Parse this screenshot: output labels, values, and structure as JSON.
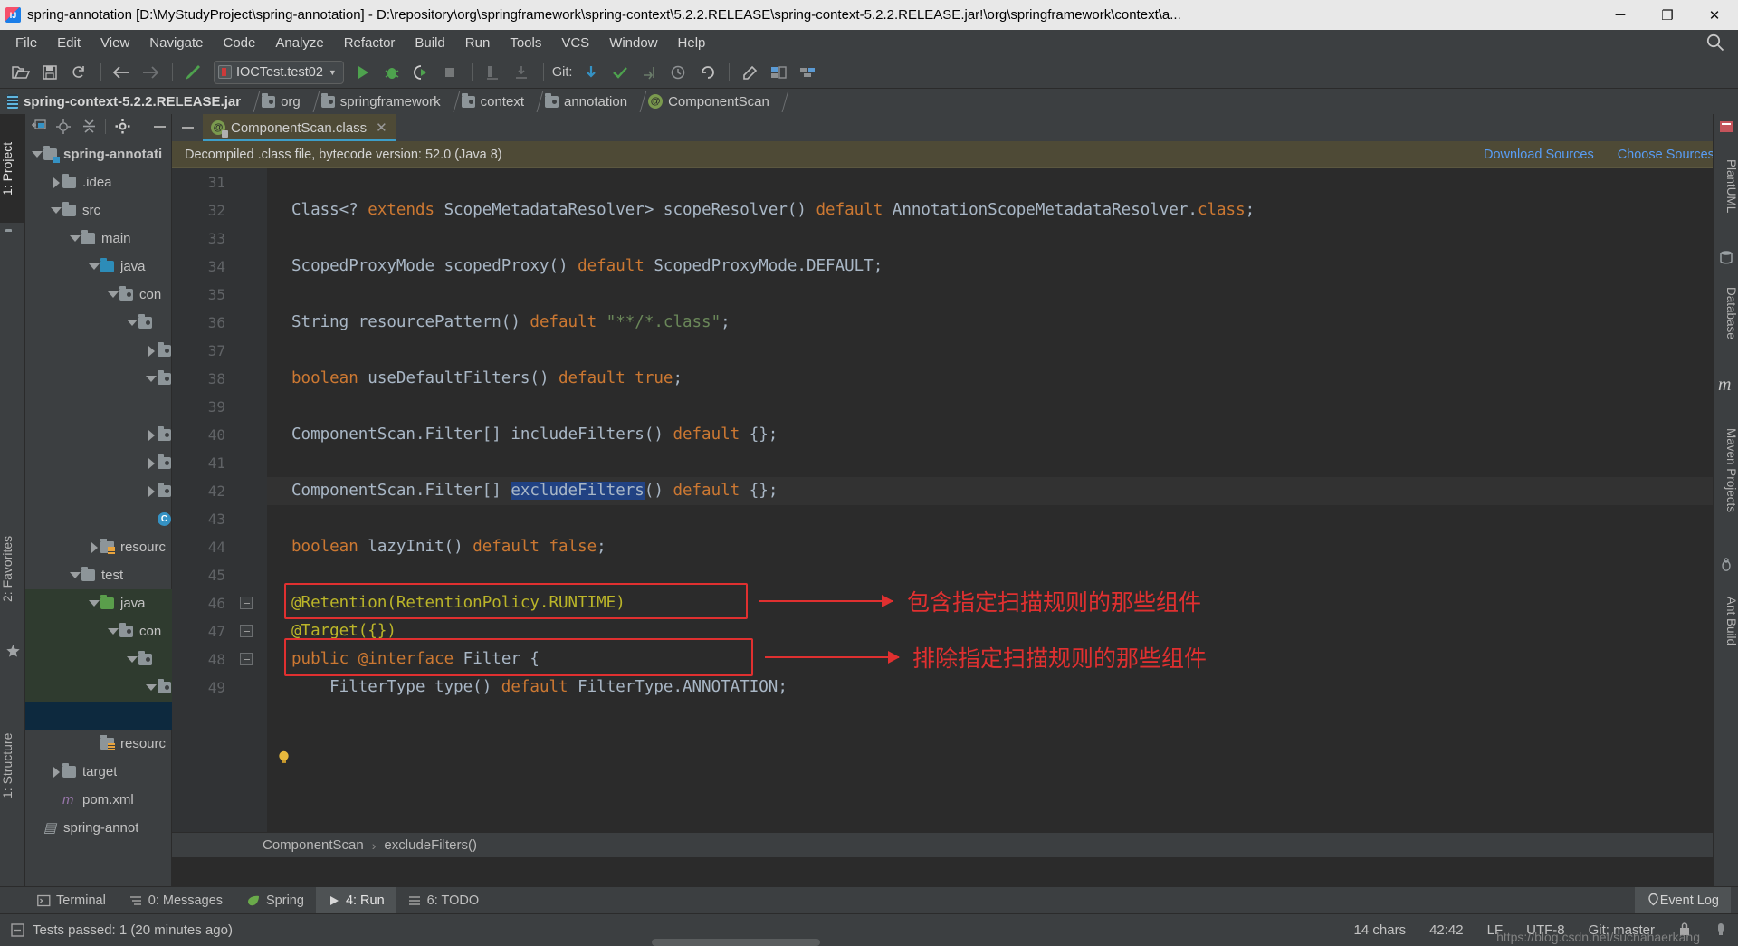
{
  "window": {
    "title": "spring-annotation [D:\\MyStudyProject\\spring-annotation] - D:\\repository\\org\\springframework\\spring-context\\5.2.2.RELEASE\\spring-context-5.2.2.RELEASE.jar!\\org\\springframework\\context\\a...",
    "minimize": "─",
    "maximize": "❐",
    "close": "✕"
  },
  "menubar": {
    "items": [
      {
        "label": "File"
      },
      {
        "label": "Edit"
      },
      {
        "label": "View"
      },
      {
        "label": "Navigate"
      },
      {
        "label": "Code"
      },
      {
        "label": "Analyze"
      },
      {
        "label": "Refactor"
      },
      {
        "label": "Build"
      },
      {
        "label": "Run"
      },
      {
        "label": "Tools"
      },
      {
        "label": "VCS"
      },
      {
        "label": "Window"
      },
      {
        "label": "Help"
      }
    ]
  },
  "toolbar": {
    "open_icon": "open-folder-icon",
    "save_icon": "save-icon",
    "sync_icon": "sync-icon",
    "back_icon": "back-arrow-icon",
    "forward_icon": "forward-arrow-icon",
    "build_icon": "build-hammer-icon",
    "run_config": "IOCTest.test02",
    "run_icon": "run-icon",
    "debug_icon": "debug-icon",
    "coverage_icon": "run-with-coverage-icon",
    "stop_icon": "stop-icon",
    "profile_icon": "profiler-icon",
    "dump_icon": "thread-dump-icon",
    "git_label": "Git:",
    "update_icon": "git-update-icon",
    "commit_icon": "git-commit-icon",
    "push_icon": "git-push-icon",
    "history_icon": "git-history-icon",
    "rollback_icon": "git-rollback-icon",
    "settings_icon": "settings-icon",
    "structure_icon": "structure-icon",
    "layout_icon": "layout-icon",
    "search_icon": "search-everywhere-icon"
  },
  "navbar": {
    "crumbs": [
      {
        "label": "spring-context-5.2.2.RELEASE.jar",
        "icon": "jar-icon"
      },
      {
        "label": "org",
        "icon": "package-icon"
      },
      {
        "label": "springframework",
        "icon": "package-icon"
      },
      {
        "label": "context",
        "icon": "package-icon"
      },
      {
        "label": "annotation",
        "icon": "package-icon"
      },
      {
        "label": "ComponentScan",
        "icon": "annotation-class-icon"
      }
    ]
  },
  "left_strip": {
    "project_tab": "1: Project",
    "favorites_tab": "2: Favorites",
    "structure_tab": "1: Structure"
  },
  "right_strip": {
    "tabs": [
      "PlantUML",
      "Database",
      "Maven Projects",
      "Ant Build"
    ]
  },
  "project_panel": {
    "toolbar_icons": [
      "select-opened-file-icon",
      "locate-icon",
      "collapse-all-icon",
      "settings-gear-icon",
      "hide-icon"
    ],
    "tree": [
      {
        "label": "spring-annotati",
        "indent": 0,
        "twist": "down",
        "icon": "module-folder-icon",
        "bold": true,
        "sel": ""
      },
      {
        "label": ".idea",
        "indent": 1,
        "twist": "right",
        "icon": "folder-icon",
        "bold": false,
        "sel": ""
      },
      {
        "label": "src",
        "indent": 1,
        "twist": "down",
        "icon": "folder-icon",
        "bold": false,
        "sel": ""
      },
      {
        "label": "main",
        "indent": 2,
        "twist": "down",
        "icon": "folder-icon",
        "bold": false,
        "sel": ""
      },
      {
        "label": "java",
        "indent": 3,
        "twist": "down",
        "icon": "source-folder-icon",
        "bold": false,
        "sel": ""
      },
      {
        "label": "con",
        "indent": 4,
        "twist": "down",
        "icon": "package-icon",
        "bold": false,
        "sel": ""
      },
      {
        "label": "",
        "indent": 5,
        "twist": "down",
        "icon": "package-icon",
        "bold": false,
        "sel": ""
      },
      {
        "label": "",
        "indent": 6,
        "twist": "right",
        "icon": "package-icon",
        "bold": false,
        "sel": ""
      },
      {
        "label": "",
        "indent": 6,
        "twist": "down",
        "icon": "package-icon",
        "bold": false,
        "sel": ""
      },
      {
        "label": "",
        "indent": 7,
        "twist": "",
        "icon": "java-class-icon",
        "bold": false,
        "sel": ""
      },
      {
        "label": "",
        "indent": 6,
        "twist": "right",
        "icon": "package-icon",
        "bold": false,
        "sel": ""
      },
      {
        "label": "",
        "indent": 6,
        "twist": "right",
        "icon": "package-icon",
        "bold": false,
        "sel": ""
      },
      {
        "label": "",
        "indent": 6,
        "twist": "right",
        "icon": "package-icon",
        "bold": false,
        "sel": ""
      },
      {
        "label": "",
        "indent": 6,
        "twist": "",
        "icon": "java-class-icon",
        "bold": false,
        "sel": ""
      },
      {
        "label": "resourc",
        "indent": 3,
        "twist": "right",
        "icon": "resources-folder-icon",
        "bold": false,
        "sel": ""
      },
      {
        "label": "test",
        "indent": 2,
        "twist": "down",
        "icon": "folder-icon",
        "bold": false,
        "sel": ""
      },
      {
        "label": "java",
        "indent": 3,
        "twist": "down",
        "icon": "test-source-folder-icon",
        "bold": false,
        "sel": "green"
      },
      {
        "label": "con",
        "indent": 4,
        "twist": "down",
        "icon": "package-icon",
        "bold": false,
        "sel": "green"
      },
      {
        "label": "",
        "indent": 5,
        "twist": "down",
        "icon": "package-icon",
        "bold": false,
        "sel": "green"
      },
      {
        "label": "",
        "indent": 6,
        "twist": "down",
        "icon": "package-icon",
        "bold": false,
        "sel": "green"
      },
      {
        "label": "",
        "indent": 7,
        "twist": "",
        "icon": "java-class-icon",
        "bold": false,
        "sel": "blue"
      },
      {
        "label": "resourc",
        "indent": 3,
        "twist": "",
        "icon": "resources-folder-icon",
        "bold": false,
        "sel": ""
      },
      {
        "label": "target",
        "indent": 1,
        "twist": "right",
        "icon": "folder-icon",
        "bold": false,
        "sel": ""
      },
      {
        "label": "pom.xml",
        "indent": 1,
        "twist": "",
        "icon": "xml-file-icon",
        "bold": false,
        "sel": ""
      },
      {
        "label": "spring-annot",
        "indent": 0,
        "twist": "",
        "icon": "iml-file-icon",
        "bold": false,
        "sel": ""
      }
    ]
  },
  "editor": {
    "tab": {
      "label": "ComponentScan.class",
      "icon": "annotation-class-icon",
      "close": "✕"
    },
    "banner": {
      "text": "Decompiled .class file, bytecode version: 52.0 (Java 8)",
      "download_sources": "Download Sources",
      "choose_sources": "Choose Sources..."
    },
    "lines": [
      {
        "num": "31",
        "segments": []
      },
      {
        "num": "32",
        "segments": [
          {
            "t": "Class<? ",
            "c": "pl"
          },
          {
            "t": "extends ",
            "c": "kw"
          },
          {
            "t": "ScopeMetadataResolver> scopeResolver() ",
            "c": "pl"
          },
          {
            "t": "default ",
            "c": "kw"
          },
          {
            "t": "AnnotationScopeMetadataResolver.",
            "c": "pl"
          },
          {
            "t": "class",
            "c": "kw"
          },
          {
            "t": ";",
            "c": "pl"
          }
        ]
      },
      {
        "num": "33",
        "segments": []
      },
      {
        "num": "34",
        "segments": [
          {
            "t": "ScopedProxyMode scopedProxy() ",
            "c": "pl"
          },
          {
            "t": "default ",
            "c": "kw"
          },
          {
            "t": "ScopedProxyMode.DEFAULT;",
            "c": "pl"
          }
        ]
      },
      {
        "num": "35",
        "segments": []
      },
      {
        "num": "36",
        "segments": [
          {
            "t": "String resourcePattern() ",
            "c": "pl"
          },
          {
            "t": "default ",
            "c": "kw"
          },
          {
            "t": "\"**/*.class\"",
            "c": "str"
          },
          {
            "t": ";",
            "c": "pl"
          }
        ]
      },
      {
        "num": "37",
        "segments": []
      },
      {
        "num": "38",
        "segments": [
          {
            "t": "boolean ",
            "c": "kw"
          },
          {
            "t": "useDefaultFilters() ",
            "c": "pl"
          },
          {
            "t": "default true",
            "c": "kw"
          },
          {
            "t": ";",
            "c": "pl"
          }
        ]
      },
      {
        "num": "39",
        "segments": []
      },
      {
        "num": "40",
        "segments": [
          {
            "t": "ComponentScan.Filter[] includeFilters() ",
            "c": "pl"
          },
          {
            "t": "default ",
            "c": "kw"
          },
          {
            "t": "{};",
            "c": "pl"
          }
        ]
      },
      {
        "num": "41",
        "segments": []
      },
      {
        "num": "42",
        "segments": [
          {
            "t": "ComponentScan.Filter[] ",
            "c": "pl"
          },
          {
            "t": "excludeFilters",
            "c": "sel-token"
          },
          {
            "t": "() ",
            "c": "pl"
          },
          {
            "t": "default ",
            "c": "kw"
          },
          {
            "t": "{};",
            "c": "pl"
          }
        ]
      },
      {
        "num": "43",
        "segments": []
      },
      {
        "num": "44",
        "segments": [
          {
            "t": "boolean ",
            "c": "kw"
          },
          {
            "t": "lazyInit() ",
            "c": "pl"
          },
          {
            "t": "default false",
            "c": "kw"
          },
          {
            "t": ";",
            "c": "pl"
          }
        ]
      },
      {
        "num": "45",
        "segments": []
      },
      {
        "num": "46",
        "segments": [
          {
            "t": "@Retention(RetentionPolicy.RUNTIME)",
            "c": "an"
          }
        ]
      },
      {
        "num": "47",
        "segments": [
          {
            "t": "@Target({})",
            "c": "an"
          }
        ]
      },
      {
        "num": "48",
        "segments": [
          {
            "t": "public ",
            "c": "kw"
          },
          {
            "t": "@interface ",
            "c": "kw"
          },
          {
            "t": "Filter {",
            "c": "pl"
          }
        ]
      },
      {
        "num": "49",
        "segments": [
          {
            "t": "    FilterType type() ",
            "c": "pl"
          },
          {
            "t": "default ",
            "c": "kw"
          },
          {
            "t": "FilterType.ANNOTATION;",
            "c": "pl"
          }
        ]
      }
    ],
    "annotations": [
      {
        "text": "包含指定扫描规则的那些组件"
      },
      {
        "text": "排除指定扫描规则的那些组件"
      }
    ],
    "annotation_color": "#e03030",
    "breadcrumb": {
      "class": "ComponentScan",
      "separator": "›",
      "member": "excludeFilters()"
    }
  },
  "bottom_bar": {
    "tabs": [
      {
        "label": "Terminal",
        "icon": "terminal-icon",
        "active": false
      },
      {
        "label": "0: Messages",
        "icon": "messages-icon",
        "active": false
      },
      {
        "label": "Spring",
        "icon": "spring-leaf-icon",
        "active": false
      },
      {
        "label": "4: Run",
        "icon": "run-icon",
        "active": true
      },
      {
        "label": "6: TODO",
        "icon": "todo-icon",
        "active": false
      }
    ],
    "event_log": {
      "label": "Event Log",
      "icon": "event-log-icon"
    }
  },
  "statusbar": {
    "left_icon": "status-info-icon",
    "message": "Tests passed: 1 (20 minutes ago)",
    "chars": "14 chars",
    "caret": "42:42",
    "line_sep": "LF",
    "encoding": "UTF-8",
    "branch": "Git: master",
    "lock_icon": "read-only-lock-icon",
    "inspect_icon": "inspection-icon"
  },
  "watermark": "https://blog.csdn.net/suchahaerkang"
}
